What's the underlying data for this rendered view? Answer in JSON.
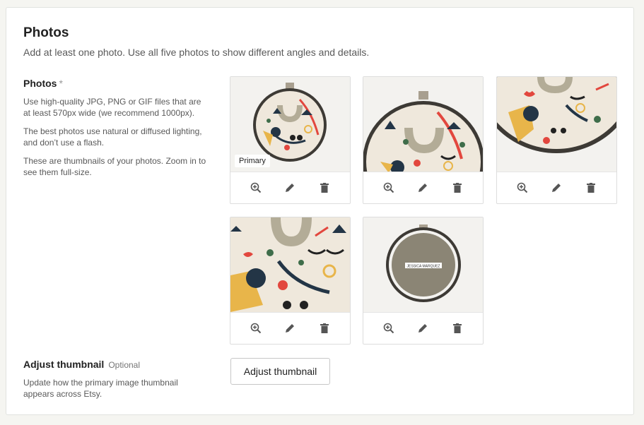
{
  "section": {
    "title": "Photos",
    "subtitle": "Add at least one photo. Use all five photos to show different angles and details."
  },
  "photos_field": {
    "label": "Photos",
    "required_mark": "*",
    "help": [
      "Use high-quality JPG, PNG or GIF files that are at least 570px wide (we recommend 1000px).",
      "The best photos use natural or diffused lighting, and don’t use a flash.",
      "These are thumbnails of your photos. Zoom in to see them full-size."
    ]
  },
  "thumbnails": {
    "primary_label": "Primary",
    "count": 5,
    "action_icons": [
      "zoom-in-icon",
      "pencil-icon",
      "trash-icon"
    ],
    "label_on_photo_5": "JESSICA MARQUEZ"
  },
  "adjust": {
    "label": "Adjust thumbnail",
    "optional": "Optional",
    "help": "Update how the primary image thumbnail appears across Etsy.",
    "button_label": "Adjust thumbnail"
  },
  "colors": {
    "linen": "#efe8dc",
    "hoop_frame": "#3d3a35",
    "red_thread": "#e2473e",
    "yellow_thread": "#e8b54a",
    "navy_thread": "#233546",
    "green_thread": "#3f6d4a",
    "action_icon": "#555555"
  }
}
